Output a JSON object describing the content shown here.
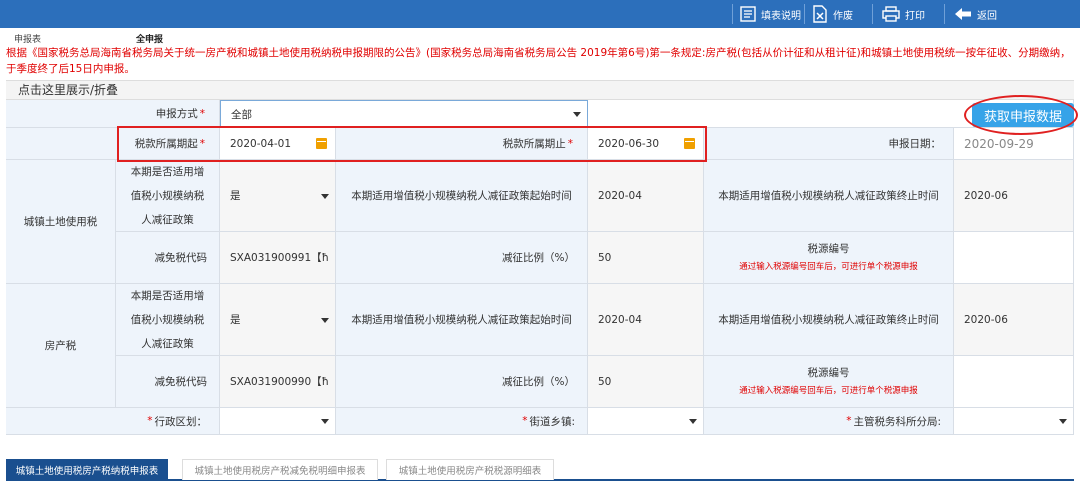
{
  "toolbar": {
    "fill_guide": "填表说明",
    "void": "作废",
    "print": "打印",
    "back": "返回"
  },
  "subnav": {
    "item1": "申报表",
    "item2": "全申报"
  },
  "notice": "根据《国家税务总局海南省税务局关于统一房产税和城镇土地使用税纳税申报期限的公告》(国家税务总局海南省税务局公告 2019年第6号)第一条规定:房产税(包括从价计征和从租计征)和城镇土地使用税统一按年征收、分期缴纳，于季度终了后15日内申报。",
  "panel": {
    "toggle": "点击这里展示/折叠"
  },
  "form": {
    "method_label": "申报方式",
    "method_value": "全部",
    "fetch_button": "获取申报数据",
    "period_start_label": "税款所属期起",
    "period_start_value": "2020-04-01",
    "period_end_label": "税款所属期止",
    "period_end_value": "2020-06-30",
    "report_date_label": "申报日期：",
    "report_date_value": "2020-09-29",
    "land": {
      "section_label": "城镇土地使用税",
      "applies_label_1": "本期是否适用增",
      "applies_label_2": "值税小规模纳税",
      "applies_label_3": "人减征政策",
      "applies_value": "是",
      "start_label": "本期适用增值税小规模纳税人减征政策起始时间",
      "start_value": "2020-04",
      "end_label": "本期适用增值税小规模纳税人减征政策终止时间",
      "end_value": "2020-06",
      "code_label": "减免税代码",
      "code_value": "SXA031900991【ħ",
      "ratio_label": "减征比例（%）",
      "ratio_value": "50",
      "source_label": "税源编号",
      "source_note": "通过输入税源编号回车后，可进行单个税源申报"
    },
    "house": {
      "section_label": "房产税",
      "applies_label_1": "本期是否适用增",
      "applies_label_2": "值税小规模纳税",
      "applies_label_3": "人减征政策",
      "applies_value": "是",
      "start_label": "本期适用增值税小规模纳税人减征政策起始时间",
      "start_value": "2020-04",
      "end_label": "本期适用增值税小规模纳税人减征政策终止时间",
      "end_value": "2020-06",
      "code_label": "减免税代码",
      "code_value": "SXA031900990【ħ",
      "ratio_label": "减征比例（%）",
      "ratio_value": "50",
      "source_label": "税源编号",
      "source_note": "通过输入税源编号回车后，可进行单个税源申报"
    },
    "district_label": "行政区划：",
    "street_label": "街道乡镇:",
    "tax_office_label": "主管税务科所分局:"
  },
  "tabs": [
    {
      "label": "城镇土地使用税房产税纳税申报表"
    },
    {
      "label": "城镇土地使用税房产税减免税明细申报表"
    },
    {
      "label": "城镇土地使用税房产税税源明细表"
    }
  ],
  "colors": {
    "toolbar": "#2c6fbb",
    "accent_red": "#e00000",
    "button_blue": "#36a3e8",
    "tab_active": "#1a4f8f"
  }
}
